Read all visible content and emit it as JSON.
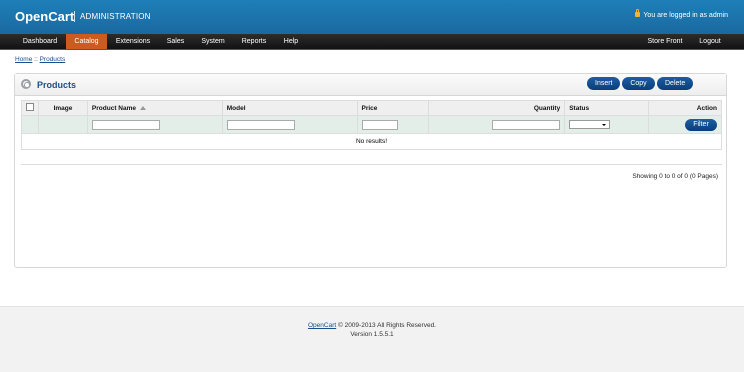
{
  "header": {
    "logo": "OpenCart",
    "admin_label": "ADMINISTRATION",
    "login_status": "You are logged in as admin",
    "brand_color": "#1f7fb8"
  },
  "menu": {
    "items": [
      {
        "label": "Dashboard",
        "active": false
      },
      {
        "label": "Catalog",
        "active": true
      },
      {
        "label": "Extensions",
        "active": false
      },
      {
        "label": "Sales",
        "active": false
      },
      {
        "label": "System",
        "active": false
      },
      {
        "label": "Reports",
        "active": false
      },
      {
        "label": "Help",
        "active": false
      }
    ],
    "right_items": [
      {
        "label": "Store Front"
      },
      {
        "label": "Logout"
      }
    ],
    "active_color": "#cd5a1e"
  },
  "breadcrumb": {
    "home": "Home",
    "separator": " :: ",
    "current": "Products"
  },
  "box": {
    "title": "Products",
    "icon": "gear-icon",
    "buttons": {
      "insert": "Insert",
      "copy": "Copy",
      "delete": "Delete"
    }
  },
  "table": {
    "columns": {
      "image": "Image",
      "product_name": "Product Name",
      "model": "Model",
      "price": "Price",
      "quantity": "Quantity",
      "status": "Status",
      "action": "Action"
    },
    "filter": {
      "name_value": "",
      "model_value": "",
      "price_value": "",
      "quantity_value": "",
      "status_value": "",
      "button": "Filter"
    },
    "no_results": "No results!"
  },
  "pagination": {
    "results": "Showing 0 to 0 of 0 (0 Pages)"
  },
  "footer": {
    "link": "OpenCart",
    "copyright": " © 2009-2013 All Rights Reserved.",
    "version": "Version 1.5.5.1"
  }
}
